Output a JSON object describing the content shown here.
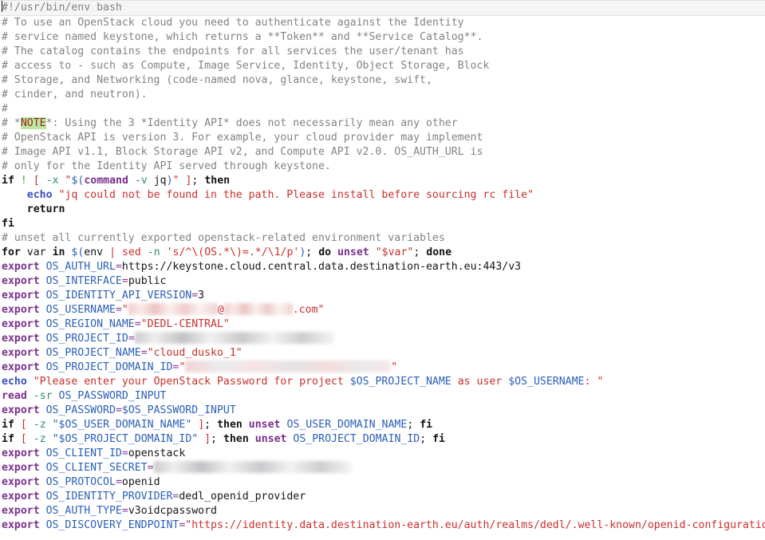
{
  "editor": {
    "file_type": "bash",
    "cursor_line": 1,
    "cursor_column": 1,
    "colors": {
      "background": "#ffffff",
      "current_line_highlight": "#f5f5f5",
      "comment": "#838383",
      "keyword": "#141414",
      "builtin": "#7a2f8f",
      "echo": "#3b4ec0",
      "variable": "#2b5fb8",
      "string": "#c9302c",
      "flag": "#2a8c73",
      "note_highlight_bg": "#b9e8a1",
      "note_highlight_fg": "#9c1f1f"
    }
  },
  "lines": {
    "l1_shebang": "#!/usr/bin/env bash",
    "l2": "# To use an OpenStack cloud you need to authenticate against the Identity",
    "l3": "# service named keystone, which returns a **Token** and **Service Catalog**.",
    "l4": "# The catalog contains the endpoints for all services the user/tenant has",
    "l5": "# access to - such as Compute, Image Service, Identity, Object Storage, Block",
    "l6": "# Storage, and Networking (code-named nova, glance, keystone, swift,",
    "l7": "# cinder, and neutron).",
    "l8": "#",
    "l9_a": "# *",
    "l9_note": "NOTE",
    "l9_b": "*: Using the 3 *Identity API* does not necessarily mean any other",
    "l10": "# OpenStack API is version 3. For example, your cloud provider may implement",
    "l11": "# Image API v1.1, Block Storage API v2, and Compute API v2.0. OS_AUTH_URL is",
    "l12": "# only for the Identity API served through keystone.",
    "l13": {
      "if": "if",
      "bang": "!",
      "lbracket": "[",
      "flag_x": "-x",
      "quote": "\"",
      "subst_open": "$(",
      "command": "command",
      "flag_v": "-v",
      "jq": "jq",
      "subst_close": ")",
      "rbracket": "]",
      "semi": ";",
      "then": "then"
    },
    "l14": {
      "indent": "    ",
      "echo": "echo",
      "string": "\"jq could not be found in the path. Please install before sourcing rc file\""
    },
    "l15": {
      "indent": "    ",
      "return": "return"
    },
    "l16_fi": "fi",
    "l17_comment": "# unset all currently exported openstack-related environment variables",
    "l18": {
      "for": "for",
      "var": "var",
      "in": "in",
      "subst_open": "$(",
      "env": "env",
      "pipe": "|",
      "sed": "sed",
      "flag_n": "-n",
      "sed_expr": "'s/^\\(OS.*\\)=.*/\\1/p'",
      "subst_close": ")",
      "semi": ";",
      "do": "do",
      "unset": "unset",
      "quoted_var": "\"$var\"",
      "semi2": ";",
      "done": "done"
    },
    "exports": [
      {
        "keyword": "export",
        "name": "OS_AUTH_URL",
        "eq": "=",
        "value": "https://keystone.cloud.central.data.destination-earth.eu:443/v3",
        "value_kind": "plain",
        "redacted": false
      },
      {
        "keyword": "export",
        "name": "OS_INTERFACE",
        "eq": "=",
        "value": "public",
        "value_kind": "plain",
        "redacted": false
      },
      {
        "keyword": "export",
        "name": "OS_IDENTITY_API_VERSION",
        "eq": "=",
        "value": "3",
        "value_kind": "plain",
        "redacted": false
      },
      {
        "keyword": "export",
        "name": "OS_USERNAME",
        "eq": "=",
        "value_kind": "string-redacted",
        "prefix": "\"",
        "redacted_before_at": true,
        "at": "@",
        "redacted_after_at": true,
        "suffix": ".com\"",
        "redacted": true
      },
      {
        "keyword": "export",
        "name": "OS_REGION_NAME",
        "eq": "=",
        "value": "\"DEDL-CENTRAL\"",
        "value_kind": "string",
        "redacted": false
      },
      {
        "keyword": "export",
        "name": "OS_PROJECT_ID",
        "eq": "=",
        "value_kind": "redacted",
        "redacted": true
      },
      {
        "keyword": "export",
        "name": "OS_PROJECT_NAME",
        "eq": "=",
        "value": "\"cloud_dusko_1\"",
        "value_kind": "string",
        "redacted": false
      },
      {
        "keyword": "export",
        "name": "OS_PROJECT_DOMAIN_ID",
        "eq": "=",
        "value_kind": "string-redacted-full",
        "prefix": "\"",
        "suffix": "\"",
        "redacted": true
      }
    ],
    "l27_echo": {
      "echo": "echo",
      "str1": "\"Please enter your OpenStack Password for project ",
      "var1": "$OS_PROJECT_NAME",
      "str2": " as user ",
      "var2": "$OS_USERNAME",
      "str3": ": \""
    },
    "l28_read": {
      "read": "read",
      "flag": "-sr",
      "name": "OS_PASSWORD_INPUT"
    },
    "l29": {
      "keyword": "export",
      "name": "OS_PASSWORD",
      "eq": "=",
      "value": "$OS_PASSWORD_INPUT"
    },
    "l30": {
      "if": "if",
      "lbracket": "[",
      "flag": "-z",
      "quoted": "\"$OS_USER_DOMAIN_NAME\"",
      "rbracket": "]",
      "semi": ";",
      "then": "then",
      "unset": "unset",
      "target": "OS_USER_DOMAIN_NAME",
      "semi2": ";",
      "fi": "fi"
    },
    "l31": {
      "if": "if",
      "lbracket": "[",
      "flag": "-z",
      "quoted": "\"$OS_PROJECT_DOMAIN_ID\"",
      "rbracket": "]",
      "semi": ";",
      "then": "then",
      "unset": "unset",
      "target": "OS_PROJECT_DOMAIN_ID",
      "semi2": ";",
      "fi": "fi"
    },
    "exports2": [
      {
        "keyword": "export",
        "name": "OS_CLIENT_ID",
        "eq": "=",
        "value": "openstack",
        "value_kind": "plain",
        "redacted": false
      },
      {
        "keyword": "export",
        "name": "OS_CLIENT_SECRET",
        "eq": "=",
        "value_kind": "redacted",
        "redacted": true
      },
      {
        "keyword": "export",
        "name": "OS_PROTOCOL",
        "eq": "=",
        "value": "openid",
        "value_kind": "plain",
        "redacted": false
      },
      {
        "keyword": "export",
        "name": "OS_IDENTITY_PROVIDER",
        "eq": "=",
        "value": "dedl_openid_provider",
        "value_kind": "plain",
        "redacted": false
      },
      {
        "keyword": "export",
        "name": "OS_AUTH_TYPE",
        "eq": "=",
        "value": "v3oidcpassword",
        "value_kind": "plain",
        "redacted": false
      },
      {
        "keyword": "export",
        "name": "OS_DISCOVERY_ENDPOINT",
        "eq": "=",
        "value": "\"https://identity.data.destination-earth.eu/auth/realms/dedl/.well-known/openid-configuration\"",
        "value_kind": "string",
        "redacted": false
      }
    ]
  }
}
